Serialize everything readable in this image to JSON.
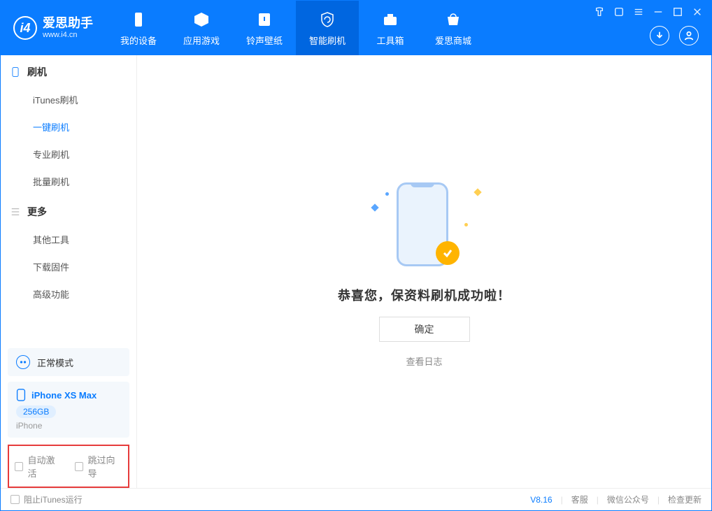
{
  "app": {
    "title": "爱思助手",
    "subtitle": "www.i4.cn"
  },
  "nav": {
    "tabs": [
      {
        "label": "我的设备"
      },
      {
        "label": "应用游戏"
      },
      {
        "label": "铃声壁纸"
      },
      {
        "label": "智能刷机"
      },
      {
        "label": "工具箱"
      },
      {
        "label": "爱思商城"
      }
    ]
  },
  "sidebar": {
    "section1": {
      "title": "刷机",
      "items": [
        "iTunes刷机",
        "一键刷机",
        "专业刷机",
        "批量刷机"
      ],
      "active_index": 1
    },
    "section2": {
      "title": "更多",
      "items": [
        "其他工具",
        "下载固件",
        "高级功能"
      ]
    },
    "mode": {
      "label": "正常模式"
    },
    "device": {
      "name": "iPhone XS Max",
      "capacity": "256GB",
      "type": "iPhone"
    },
    "checks": {
      "auto_activate": "自动激活",
      "skip_guide": "跳过向导"
    }
  },
  "main": {
    "message": "恭喜您，保资料刷机成功啦！",
    "ok_label": "确定",
    "log_label": "查看日志"
  },
  "footer": {
    "block_itunes": "阻止iTunes运行",
    "version": "V8.16",
    "links": [
      "客服",
      "微信公众号",
      "检查更新"
    ]
  }
}
